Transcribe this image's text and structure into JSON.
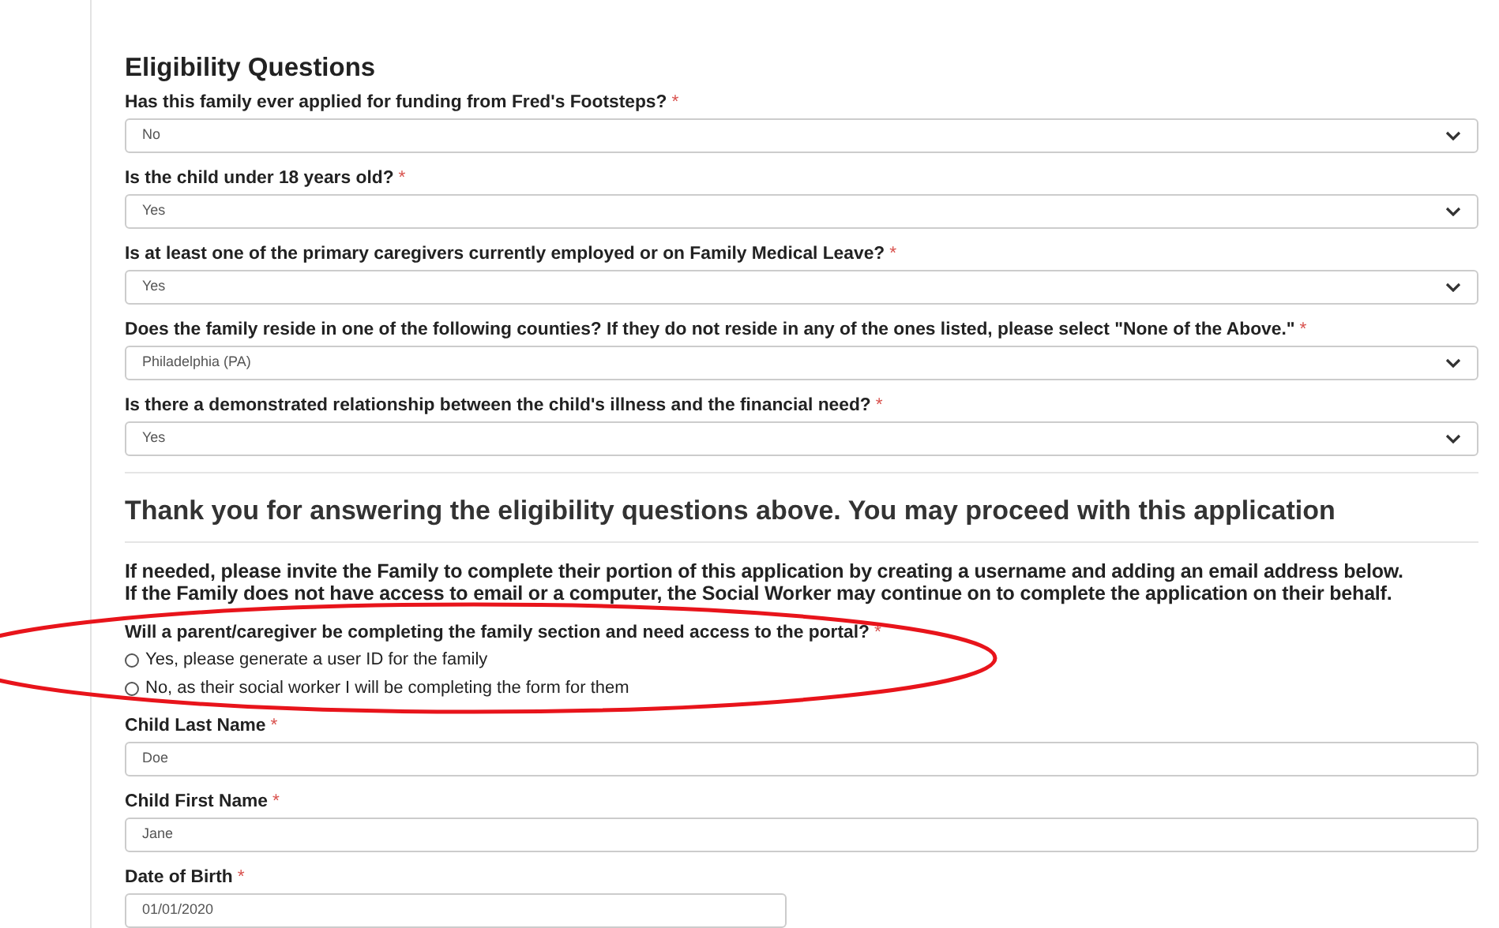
{
  "eligibility": {
    "title": "Eligibility Questions",
    "questions": [
      {
        "label": "Has this family ever applied for funding from Fred's Footsteps?",
        "required_mark": "*",
        "value": "No"
      },
      {
        "label": "Is the child under 18 years old?",
        "required_mark": "*",
        "value": "Yes"
      },
      {
        "label": "Is at least one of the primary caregivers currently employed or on Family Medical Leave?",
        "required_mark": "*",
        "value": "Yes"
      },
      {
        "label": "Does the family reside in one of the following counties? If they do not reside in any of the ones listed, please select \"None of the Above.\"",
        "required_mark": "*",
        "value": "Philadelphia (PA)"
      },
      {
        "label": "Is there a demonstrated relationship between the child's illness and the financial need?",
        "required_mark": "*",
        "value": "Yes"
      }
    ]
  },
  "application": {
    "title": "Thank you for answering the eligibility questions above. You may proceed with this application",
    "notice": [
      "If needed, please invite the Family to complete their portion of this application by creating a username and adding an email address below.",
      "If the Family does not have access to email or a computer, the Social Worker may continue on to complete the application on their behalf."
    ],
    "portal_question": {
      "label": "Will a parent/caregiver be completing the family section and need access to the portal?",
      "required_mark": "*",
      "options": [
        {
          "label": "Yes, please generate a user ID for the family",
          "selected": false
        },
        {
          "label": "No, as their social worker I will be completing the form for them",
          "selected": false
        }
      ]
    },
    "fields": [
      {
        "label": "Child Last Name",
        "required_mark": "*",
        "value": "Doe",
        "kind": "text"
      },
      {
        "label": "Child First Name",
        "required_mark": "*",
        "value": "Jane",
        "kind": "text"
      },
      {
        "label": "Date of Birth",
        "required_mark": "*",
        "value": "01/01/2020",
        "kind": "date"
      }
    ]
  },
  "annotations": [
    {
      "kind": "ellipse",
      "color": "#e8141b"
    }
  ]
}
